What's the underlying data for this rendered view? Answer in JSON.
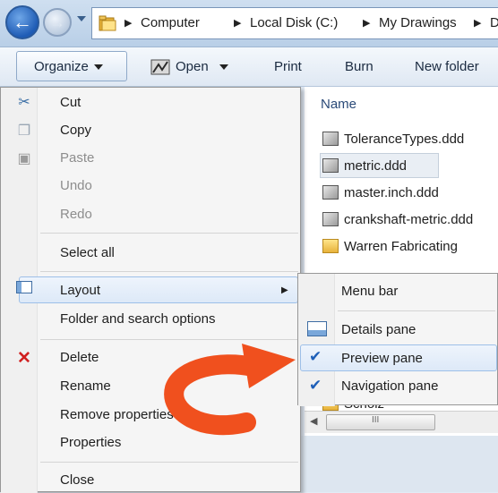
{
  "breadcrumb": [
    "Computer",
    "Local Disk (C:)",
    "My Drawings",
    "D"
  ],
  "toolbar": {
    "organize": "Organize",
    "open": "Open",
    "print": "Print",
    "burn": "Burn",
    "new_folder": "New folder"
  },
  "file_pane": {
    "column_name": "Name",
    "files": [
      {
        "name": "ToleranceTypes.ddd",
        "icon": "drawing-file-icon"
      },
      {
        "name": "metric.ddd",
        "icon": "drawing-file-icon",
        "selected": true
      },
      {
        "name": "master.inch.ddd",
        "icon": "drawing-file-icon"
      },
      {
        "name": "crankshaft-metric.ddd",
        "icon": "drawing-file-icon"
      },
      {
        "name": "Warren Fabricating",
        "icon": "folder-icon"
      },
      {
        "name": "Scholz",
        "icon": "folder-icon"
      }
    ],
    "scrollbar_grip": "III"
  },
  "organize_menu": {
    "cut": "Cut",
    "copy": "Copy",
    "paste": "Paste",
    "undo": "Undo",
    "redo": "Redo",
    "select_all": "Select all",
    "layout": "Layout",
    "folder_options": "Folder and search options",
    "delete": "Delete",
    "rename": "Rename",
    "remove_properties": "Remove properties",
    "properties": "Properties",
    "close": "Close"
  },
  "layout_submenu": {
    "menu_bar": "Menu bar",
    "details_pane": "Details pane",
    "preview_pane": "Preview pane",
    "navigation_pane": "Navigation pane",
    "checked": [
      "Preview pane",
      "Navigation pane"
    ]
  },
  "colors": {
    "highlight_border": "#9dbfe8",
    "annotation_arrow": "#f0501e",
    "checkmark": "#1e5fb8"
  }
}
